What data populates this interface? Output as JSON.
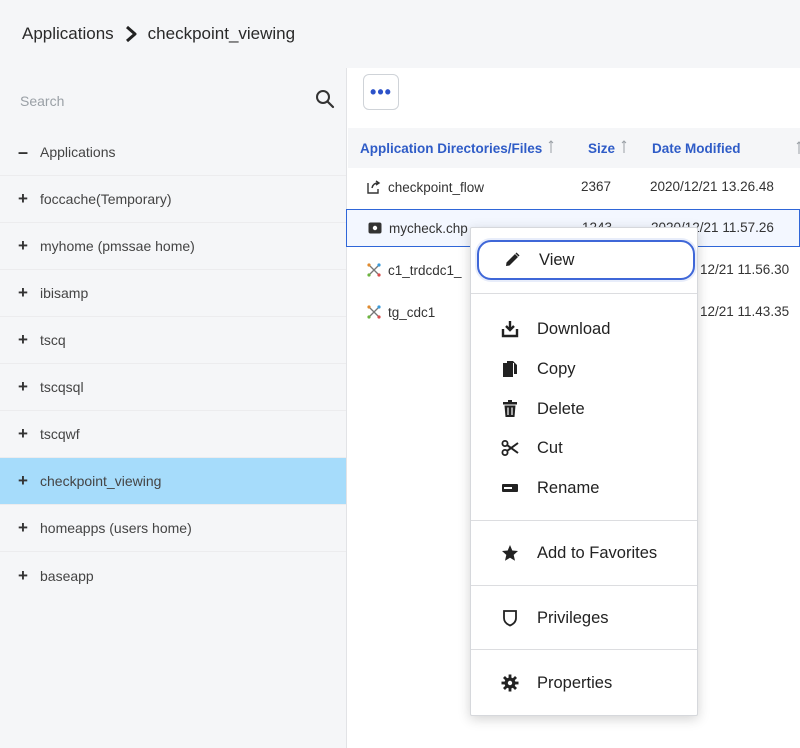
{
  "breadcrumb": {
    "root": "Applications",
    "current": "checkpoint_viewing"
  },
  "sidebar": {
    "search_placeholder": "Search",
    "root_label": "Applications",
    "items": [
      {
        "label": "foccache(Temporary)"
      },
      {
        "label": "myhome (pmssae home)"
      },
      {
        "label": "ibisamp"
      },
      {
        "label": "tscq"
      },
      {
        "label": "tscqsql"
      },
      {
        "label": "tscqwf"
      },
      {
        "label": "checkpoint_viewing",
        "selected": true
      },
      {
        "label": "homeapps (users home)"
      },
      {
        "label": "baseapp"
      }
    ]
  },
  "toolbar": {
    "more_label": "•••"
  },
  "table": {
    "headers": [
      "Application Directories/Files",
      "Size",
      "Date Modified"
    ],
    "rows": [
      {
        "name": "checkpoint_flow",
        "size": "2367",
        "date": "2020/12/21 13.26.48",
        "icon": "flow-icon"
      },
      {
        "name": "mycheck.chp",
        "size": "1243",
        "date": "2020/12/21 11.57.26",
        "icon": "checkpoint-file-icon"
      },
      {
        "name": "c1_trdcdc1_",
        "size": "",
        "date": "12/21 11.56.30",
        "icon": "etl-icon"
      },
      {
        "name": "tg_cdc1",
        "size": "",
        "date": "12/21 11.43.35",
        "icon": "etl-icon"
      }
    ]
  },
  "context_menu": {
    "view": "View",
    "download": "Download",
    "copy": "Copy",
    "delete": "Delete",
    "cut": "Cut",
    "rename": "Rename",
    "add_to_favorites": "Add to Favorites",
    "privileges": "Privileges",
    "properties": "Properties"
  },
  "colors": {
    "accent": "#2f5cc7",
    "selected_row": "#a6dcfb",
    "highlight_border": "#3f67d8"
  }
}
